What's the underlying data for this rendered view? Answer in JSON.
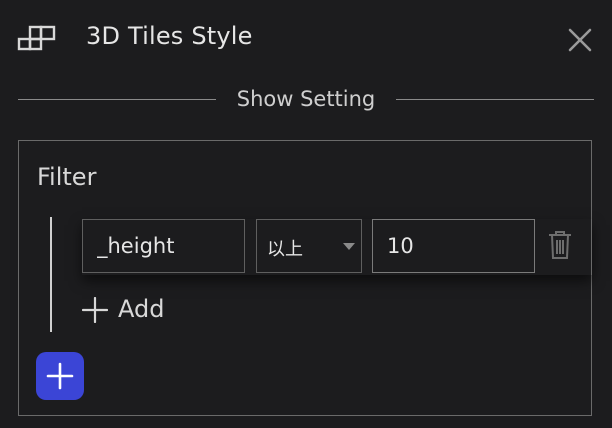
{
  "header": {
    "title": "3D Tiles Style",
    "icon": "tiles-icon",
    "close_icon": "close-icon"
  },
  "section": {
    "label": "Show Setting"
  },
  "filter": {
    "title": "Filter",
    "condition": {
      "field_value": "_height",
      "operator_value": "以上",
      "input_value": "10",
      "delete_icon": "trash-icon"
    },
    "add_label": "Add",
    "add_group_icon": "plus-icon",
    "accent_color": "#3b45d6"
  }
}
